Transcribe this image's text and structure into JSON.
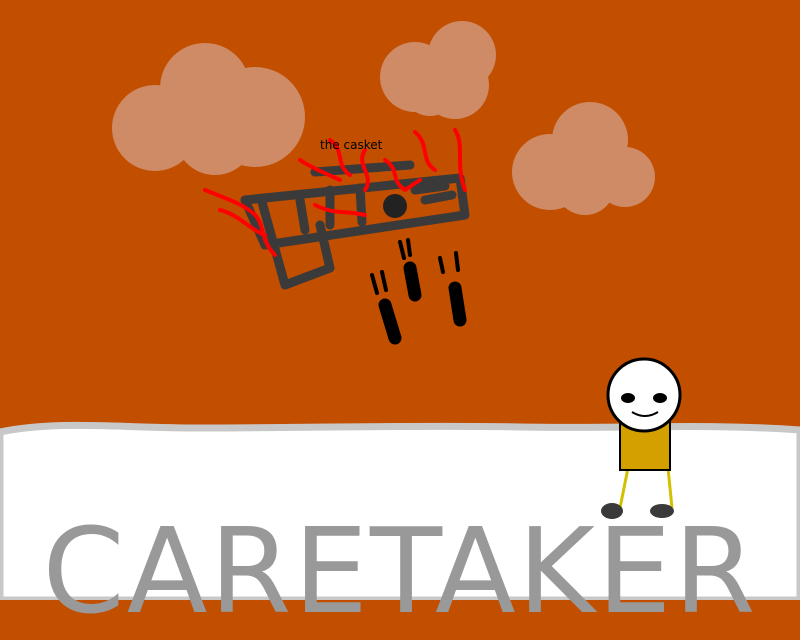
{
  "scene": {
    "casket_label": "the casket",
    "title": "CARETAKER"
  },
  "colors": {
    "sky": "#c24e00",
    "cloud": "#cf8a66",
    "ground": "#ffffff",
    "ground_edge": "#c8c8c8",
    "casket": "#3a3a3a",
    "flame": "#ff0000",
    "footprint": "#000000",
    "title": "#999999",
    "caretaker_shirt": "#d4a000",
    "caretaker_legs": "#d4c000"
  },
  "icons": [
    "cloud-icon",
    "casket-icon",
    "flame-icon",
    "footprint-icon",
    "caretaker-character"
  ]
}
